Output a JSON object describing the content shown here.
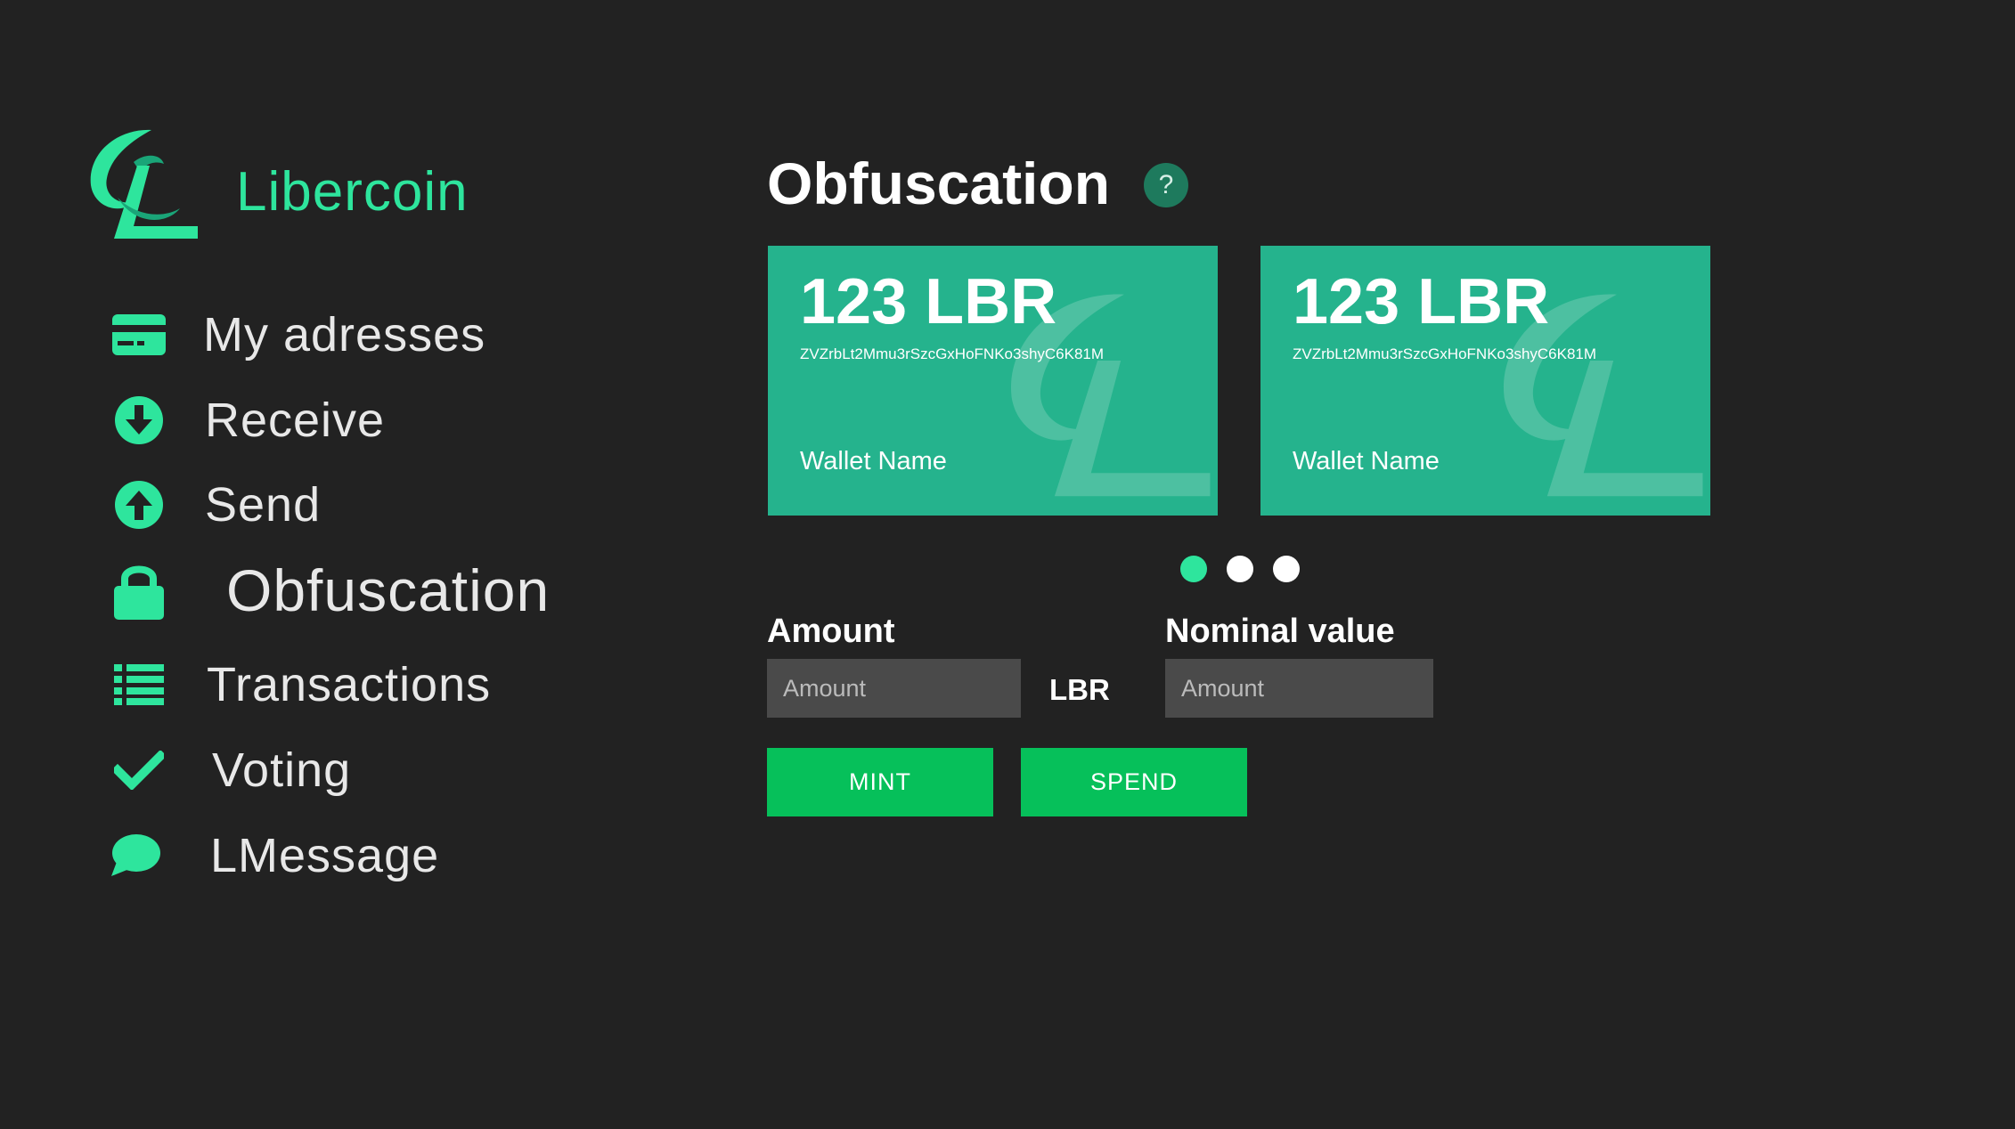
{
  "app": {
    "brand": "Libercoin",
    "accent_color": "#2ee59d",
    "background_color": "#222222"
  },
  "sidebar": {
    "items": [
      {
        "label": "My adresses",
        "icon": "card-icon"
      },
      {
        "label": "Receive",
        "icon": "download-circle-icon"
      },
      {
        "label": "Send",
        "icon": "upload-circle-icon"
      },
      {
        "label": "Obfuscation",
        "icon": "lock-icon",
        "active": true
      },
      {
        "label": "Transactions",
        "icon": "list-icon"
      },
      {
        "label": "Voting",
        "icon": "check-icon"
      },
      {
        "label": "LMessage",
        "icon": "chat-bubble-icon"
      }
    ]
  },
  "main": {
    "title": "Obfuscation",
    "help_icon": "?",
    "cards": [
      {
        "amount": "123 LBR",
        "address": "ZVZrbLt2Mmu3rSzcGxHoFNKo3shyC6K81M",
        "wallet_name": "Wallet Name",
        "color": "#25b38d"
      },
      {
        "amount": "123 LBR",
        "address": "ZVZrbLt2Mmu3rSzcGxHoFNKo3shyC6K81M",
        "wallet_name": "Wallet Name",
        "color": "#25b38d"
      }
    ],
    "pagination": {
      "count": 3,
      "active_index": 0
    },
    "amount_label": "Amount",
    "amount_placeholder": "Amount",
    "unit": "LBR",
    "nominal_label": "Nominal value",
    "nominal_placeholder": "Amount",
    "mint_label": "MINT",
    "spend_label": "SPEND",
    "button_color": "#06c05a"
  }
}
